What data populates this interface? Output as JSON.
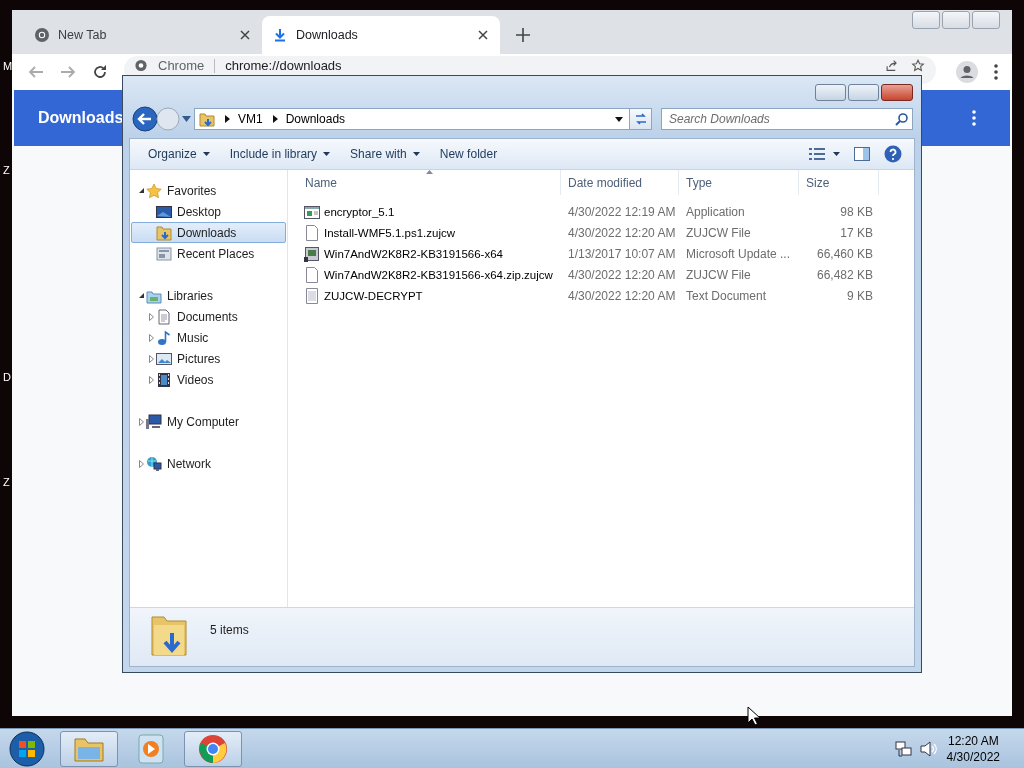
{
  "desktop": {
    "icon_labels": [
      "M",
      "Z",
      "D",
      "Z"
    ]
  },
  "browser": {
    "tabs": [
      {
        "label": "New Tab",
        "kind": "newtab",
        "selected": false
      },
      {
        "label": "Downloads",
        "kind": "downloads",
        "selected": true
      }
    ],
    "address": {
      "site_label": "Chrome",
      "url": "chrome://downloads"
    },
    "page_title": "Downloads"
  },
  "explorer": {
    "breadcrumb": [
      "VM1",
      "Downloads"
    ],
    "search": {
      "placeholder": "Search Downloads"
    },
    "commands": [
      {
        "label": "Organize",
        "menu": true
      },
      {
        "label": "Include in library",
        "menu": true
      },
      {
        "label": "Share with",
        "menu": true
      },
      {
        "label": "New folder",
        "menu": false
      }
    ],
    "nav_tree": [
      {
        "label": "Favorites",
        "kind": "favorites",
        "expanded": true,
        "selected": false,
        "children": [
          {
            "label": "Desktop",
            "kind": "desktop",
            "selected": false
          },
          {
            "label": "Downloads",
            "kind": "downloads",
            "selected": true
          },
          {
            "label": "Recent Places",
            "kind": "recent",
            "selected": false
          }
        ]
      },
      {
        "label": "Libraries",
        "kind": "libraries",
        "expanded": true,
        "selected": false,
        "children": [
          {
            "label": "Documents",
            "kind": "documents",
            "expanded": false,
            "selected": false
          },
          {
            "label": "Music",
            "kind": "music",
            "expanded": false,
            "selected": false
          },
          {
            "label": "Pictures",
            "kind": "pictures",
            "expanded": false,
            "selected": false
          },
          {
            "label": "Videos",
            "kind": "videos",
            "expanded": false,
            "selected": false
          }
        ]
      },
      {
        "label": "My Computer",
        "kind": "computer",
        "expanded": false,
        "selected": false
      },
      {
        "label": "Network",
        "kind": "network",
        "expanded": false,
        "selected": false
      }
    ],
    "columns": [
      {
        "label": "Name",
        "sorted": true
      },
      {
        "label": "Date modified",
        "sorted": false
      },
      {
        "label": "Type",
        "sorted": false
      },
      {
        "label": "Size",
        "sorted": false
      }
    ],
    "files": [
      {
        "name": "encryptor_5.1",
        "kind": "application",
        "date": "4/30/2022 12:19 AM",
        "type": "Application",
        "size": "98 KB"
      },
      {
        "name": "Install-WMF5.1.ps1.zujcw",
        "kind": "blank",
        "date": "4/30/2022 12:20 AM",
        "type": "ZUJCW File",
        "size": "17 KB"
      },
      {
        "name": "Win7AndW2K8R2-KB3191566-x64",
        "kind": "update",
        "date": "1/13/2017 10:07 AM",
        "type": "Microsoft Update ...",
        "size": "66,460 KB"
      },
      {
        "name": "Win7AndW2K8R2-KB3191566-x64.zip.zujcw",
        "kind": "blank",
        "date": "4/30/2022 12:20 AM",
        "type": "ZUJCW File",
        "size": "66,482 KB"
      },
      {
        "name": "ZUJCW-DECRYPT",
        "kind": "text",
        "date": "4/30/2022 12:20 AM",
        "type": "Text Document",
        "size": "9 KB"
      }
    ],
    "status": "5 items"
  },
  "taskbar": {
    "buttons": [
      {
        "kind": "explorer",
        "selected": true
      },
      {
        "kind": "media",
        "selected": false
      },
      {
        "kind": "chrome",
        "selected": true
      }
    ],
    "clock": {
      "time": "12:20 AM",
      "date": "4/30/2022"
    }
  }
}
